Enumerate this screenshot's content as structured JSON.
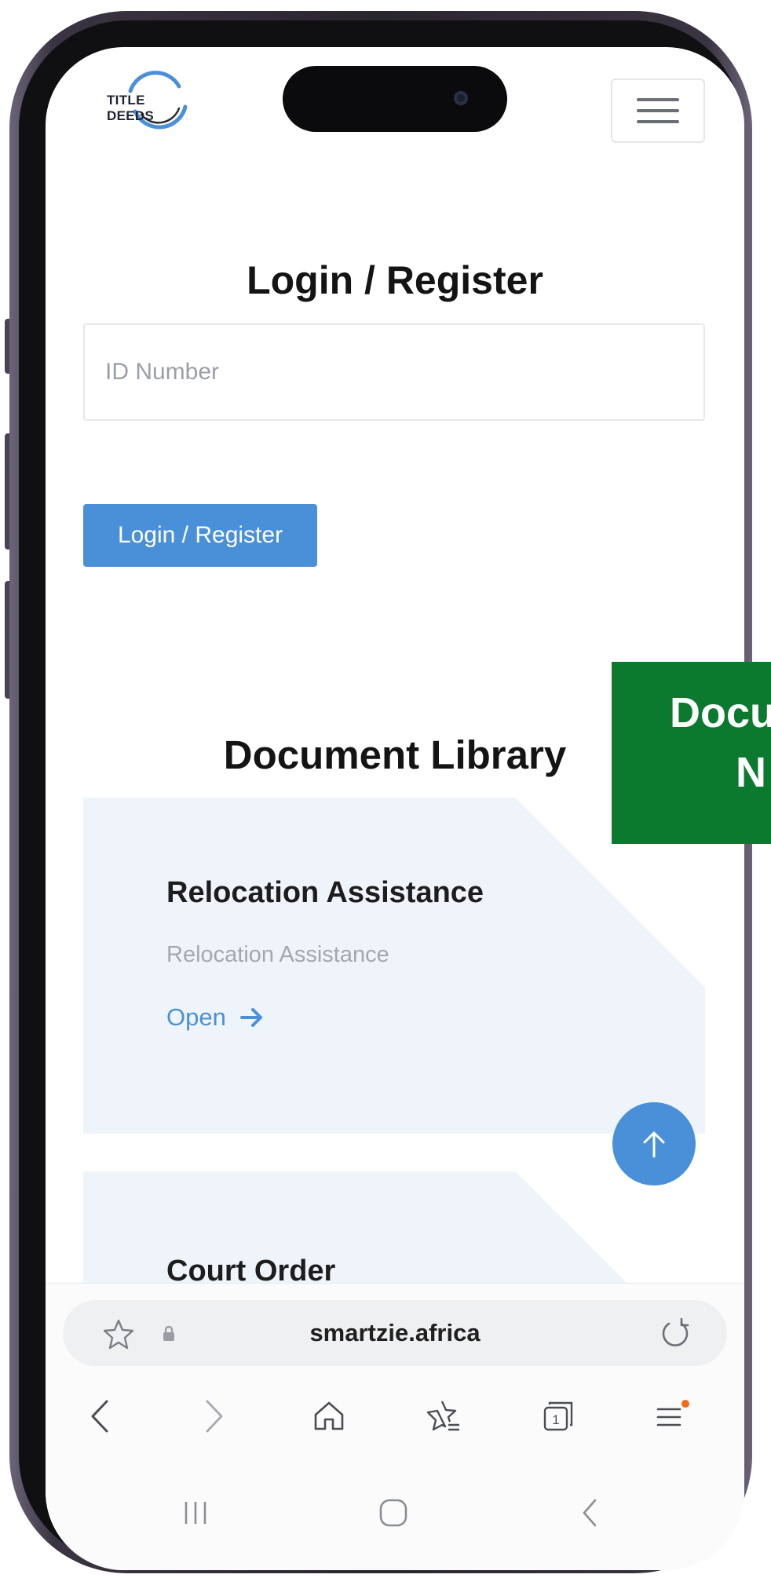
{
  "header": {
    "logo_text": "TITLE DEEDS",
    "menu_icon": "hamburger-menu-icon"
  },
  "login": {
    "title": "Login / Register",
    "id_placeholder": "ID Number",
    "button_label": "Login / Register"
  },
  "library": {
    "title": "Document Library",
    "cards": [
      {
        "title": "Relocation Assistance",
        "subtitle": "Relocation Assistance",
        "link_label": "Open"
      },
      {
        "title": "Court Order"
      }
    ]
  },
  "banner": {
    "line1": "Docu",
    "line2": "N"
  },
  "browser": {
    "url": "smartzie.africa",
    "icons": [
      "star-icon",
      "lock-icon",
      "reload-icon",
      "back-icon",
      "forward-icon",
      "home-icon",
      "bookmarks-icon",
      "tabs-icon",
      "menu-icon"
    ],
    "tab_count": "1"
  },
  "colors": {
    "accent": "#4a90d9",
    "banner": "#0b7a2f",
    "card": "#eff4fb"
  }
}
